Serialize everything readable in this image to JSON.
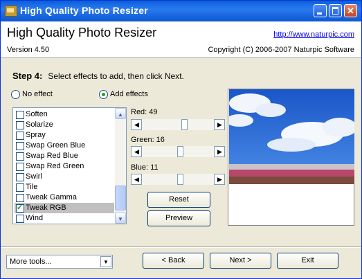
{
  "window": {
    "title": "High Quality Photo Resizer"
  },
  "header": {
    "app_title": "High Quality Photo Resizer",
    "version": "Version 4.50",
    "url": "http://www.naturpic.com",
    "copyright": "Copyright (C) 2006-2007 Naturpic Software"
  },
  "step": {
    "label": "Step 4:",
    "instruction": "Select effects to add, then click Next."
  },
  "mode": {
    "no_effect": "No effect",
    "add_effects": "Add effects",
    "selected": "Add effects"
  },
  "effects": {
    "items": [
      {
        "label": "Soften",
        "checked": false
      },
      {
        "label": "Solarize",
        "checked": false
      },
      {
        "label": "Spray",
        "checked": false
      },
      {
        "label": "Swap Green Blue",
        "checked": false
      },
      {
        "label": "Swap Red Blue",
        "checked": false
      },
      {
        "label": "Swap Red Green",
        "checked": false
      },
      {
        "label": "Swirl",
        "checked": false
      },
      {
        "label": "Tile",
        "checked": false
      },
      {
        "label": "Tweak Gamma",
        "checked": false
      },
      {
        "label": "Tweak RGB",
        "checked": true
      },
      {
        "label": "Wind",
        "checked": false
      }
    ],
    "selected_index": 9
  },
  "sliders": [
    {
      "label": "Red: 49",
      "value": 49
    },
    {
      "label": "Green: 16",
      "value": 16
    },
    {
      "label": "Blue: 11",
      "value": 11
    }
  ],
  "buttons": {
    "reset": "Reset",
    "preview": "Preview",
    "back": "< Back",
    "next": "Next >",
    "exit": "Exit"
  },
  "more_tools": {
    "value": "More tools..."
  },
  "icons": {
    "scroll_up": "▲",
    "scroll_down": "▼",
    "left": "◀",
    "right": "▶",
    "dropdown": "▼"
  },
  "colors": {
    "titlebar": "#0a5fd8",
    "window_bg": "#ece9d8",
    "link": "#0000ee"
  }
}
